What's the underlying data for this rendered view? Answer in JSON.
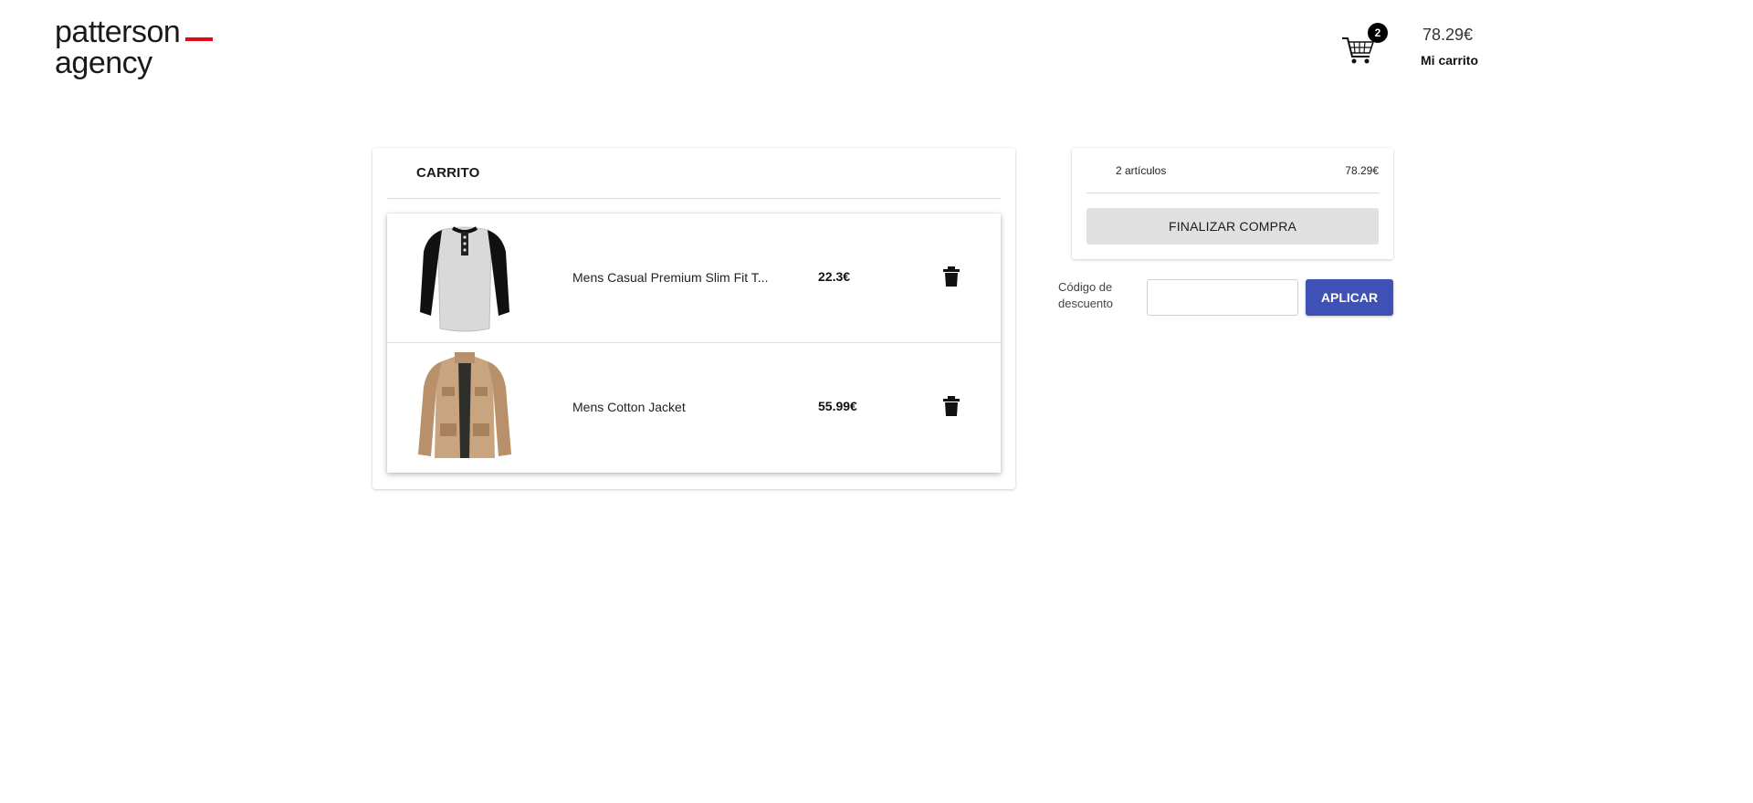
{
  "header": {
    "logo_line1": "patterson",
    "logo_line2": "agency",
    "cart": {
      "badge_count": "2",
      "total": "78.29€",
      "label": "Mi carrito"
    }
  },
  "cart": {
    "title": "CARRITO",
    "items": [
      {
        "name": "Mens Casual Premium Slim Fit T...",
        "price": "22.3€",
        "image": "raglan-henley-shirt"
      },
      {
        "name": "Mens Cotton Jacket",
        "price": "55.99€",
        "image": "khaki-cotton-jacket"
      }
    ]
  },
  "summary": {
    "item_count": "2 artículos",
    "total": "78.29€",
    "checkout_label": "FINALIZAR COMPRA"
  },
  "discount": {
    "label": "Código de descuento",
    "input_value": "",
    "apply_label": "APLICAR"
  },
  "colors": {
    "brand_accent": "#e30613",
    "primary_button": "#3f51b5",
    "checkout_button": "#e0e0e0"
  }
}
